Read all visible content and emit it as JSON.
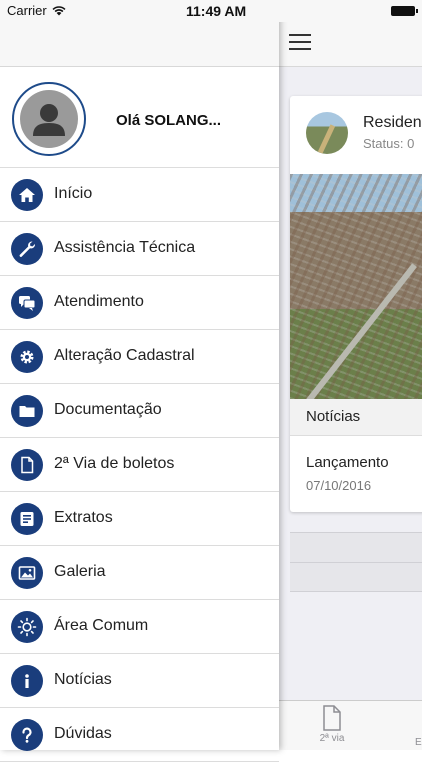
{
  "status_bar": {
    "carrier": "Carrier",
    "time": "11:49 AM"
  },
  "drawer": {
    "greeting": "Olá SOLANG...",
    "menu": [
      {
        "label": "Início",
        "icon": "home-icon"
      },
      {
        "label": "Assistência Técnica",
        "icon": "wrench-icon"
      },
      {
        "label": "Atendimento",
        "icon": "chat-icon"
      },
      {
        "label": "Alteração Cadastral",
        "icon": "gear-icon"
      },
      {
        "label": "Documentação",
        "icon": "folder-icon"
      },
      {
        "label": "2ª Via de boletos",
        "icon": "document-icon"
      },
      {
        "label": "Extratos",
        "icon": "statement-icon"
      },
      {
        "label": "Galeria",
        "icon": "gallery-icon"
      },
      {
        "label": "Área Comum",
        "icon": "sun-icon"
      },
      {
        "label": "Notícias",
        "icon": "info-icon"
      },
      {
        "label": "Dúvidas",
        "icon": "help-icon"
      }
    ]
  },
  "main": {
    "card": {
      "title": "Residen",
      "status": "Status: 0",
      "section_label": "Notícias",
      "news_title": "Lançamento",
      "news_date": "07/10/2016"
    },
    "tabbar": {
      "tab1_label": "2ª via",
      "tab2_label": "E"
    }
  },
  "colors": {
    "accent": "#1a3d7c",
    "avatar_border": "#1e4b8a"
  }
}
